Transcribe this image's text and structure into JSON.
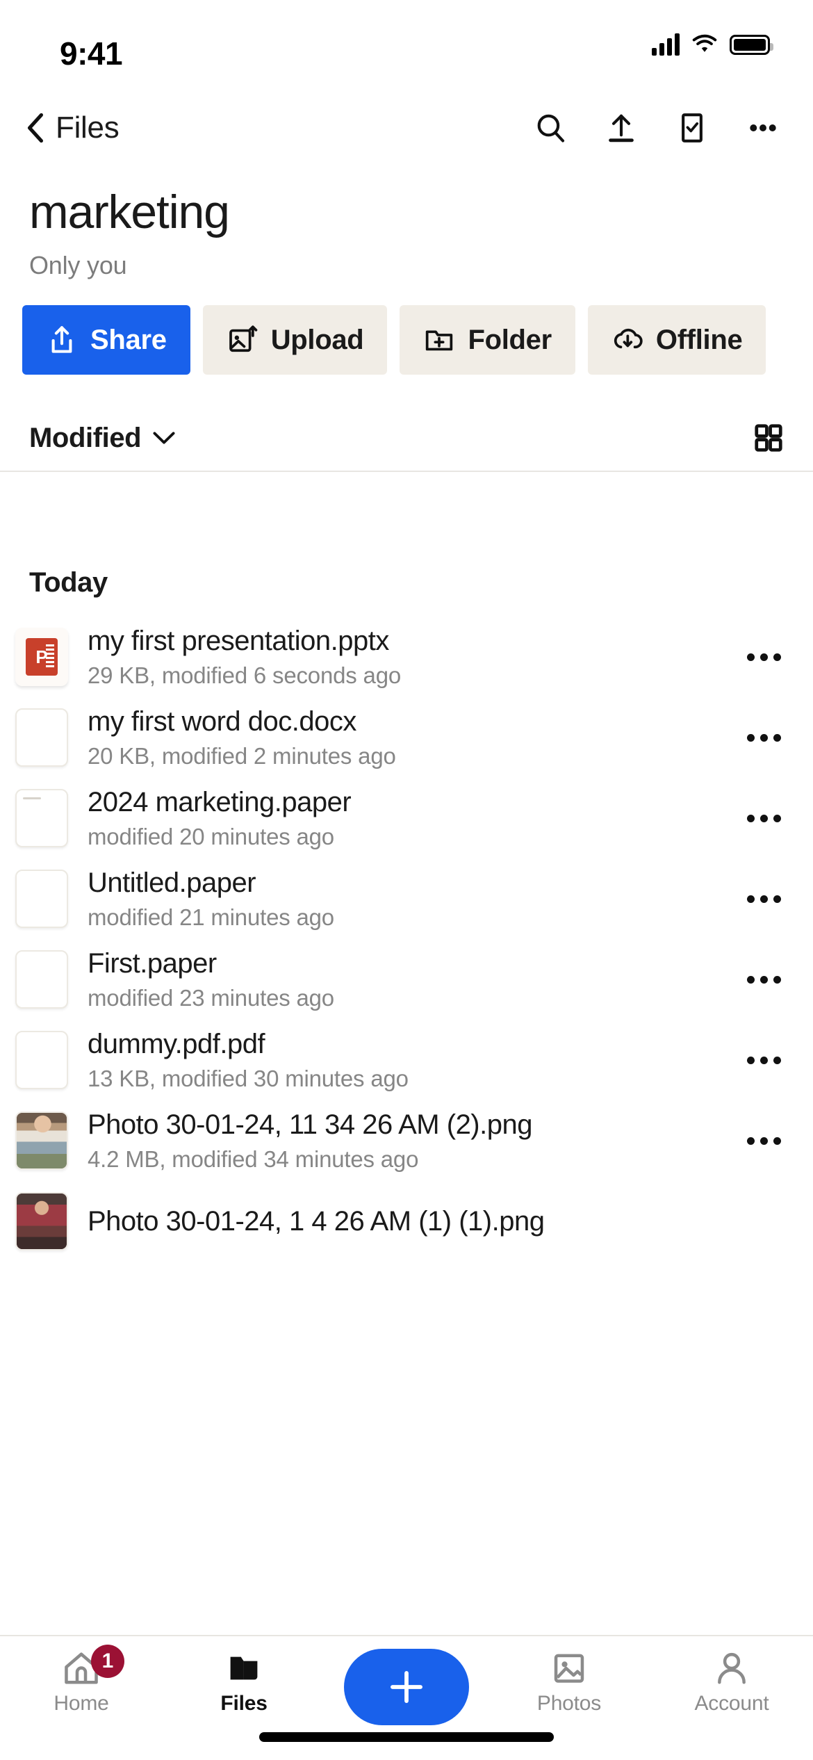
{
  "status_bar": {
    "time": "9:41",
    "signal_icon": "cellular-signal-icon",
    "wifi_icon": "wifi-icon",
    "battery_icon": "battery-full-icon"
  },
  "navbar": {
    "back_label": "Files",
    "back_icon": "chevron-left-icon",
    "actions": [
      {
        "name": "search-icon",
        "label": "Search"
      },
      {
        "name": "upload-icon",
        "label": "Upload"
      },
      {
        "name": "select-checkbox-icon",
        "label": "Select"
      },
      {
        "name": "more-horizontal-icon",
        "label": "More"
      }
    ]
  },
  "header": {
    "title": "marketing",
    "subtitle": "Only you"
  },
  "quick_actions": [
    {
      "label": "Share",
      "icon": "share-icon",
      "primary": true
    },
    {
      "label": "Upload",
      "icon": "image-upload-icon",
      "primary": false
    },
    {
      "label": "Folder",
      "icon": "folder-plus-icon",
      "primary": false
    },
    {
      "label": "Offline",
      "icon": "cloud-download-icon",
      "primary": false
    }
  ],
  "sort_bar": {
    "sort_label": "Modified",
    "sort_chevron_icon": "chevron-down-icon",
    "view_toggle_icon": "grid-view-icon"
  },
  "file_list": {
    "group_label": "Today",
    "items": [
      {
        "name": "my first presentation.pptx",
        "meta": "29 KB, modified 6 seconds ago",
        "thumb_type": "pptx",
        "thumb_glyph": "P",
        "more_icon": "more-horizontal-icon"
      },
      {
        "name": "my first word doc.docx",
        "meta": "20 KB, modified 2 minutes ago",
        "thumb_type": "blank",
        "thumb_glyph": "",
        "more_icon": "more-horizontal-icon"
      },
      {
        "name": "2024 marketing.paper",
        "meta": "modified 20 minutes ago",
        "thumb_type": "paper",
        "thumb_glyph": "",
        "more_icon": "more-horizontal-icon"
      },
      {
        "name": "Untitled.paper",
        "meta": "modified 21 minutes ago",
        "thumb_type": "blank",
        "thumb_glyph": "",
        "more_icon": "more-horizontal-icon"
      },
      {
        "name": "First.paper",
        "meta": "modified 23 minutes ago",
        "thumb_type": "blank",
        "thumb_glyph": "",
        "more_icon": "more-horizontal-icon"
      },
      {
        "name": "dummy.pdf.pdf",
        "meta": "13 KB, modified 30 minutes ago",
        "thumb_type": "blank",
        "thumb_glyph": "",
        "more_icon": "more-horizontal-icon"
      },
      {
        "name": "Photo 30-01-24, 11 34 26 AM (2).png",
        "meta": "4.2 MB, modified 34 minutes ago",
        "thumb_type": "photo-a",
        "thumb_glyph": "",
        "more_icon": "more-horizontal-icon"
      },
      {
        "name": "Photo 30-01-24, 1  4 26 AM (1) (1).png",
        "meta": "",
        "thumb_type": "photo-b",
        "thumb_glyph": "",
        "more_icon": "more-horizontal-icon"
      }
    ]
  },
  "tabbar": {
    "tabs": [
      {
        "label": "Home",
        "icon": "home-icon",
        "badge": "1",
        "active": false
      },
      {
        "label": "Files",
        "icon": "folder-icon",
        "badge": "",
        "active": true
      },
      {
        "label": "",
        "icon": "plus-icon",
        "badge": "",
        "active": false
      },
      {
        "label": "Photos",
        "icon": "photo-icon",
        "badge": "",
        "active": false
      },
      {
        "label": "Account",
        "icon": "person-icon",
        "badge": "",
        "active": false
      }
    ]
  },
  "colors": {
    "brand_blue": "#1961eb",
    "action_surface": "#f1ede6",
    "badge_red": "#9b1134",
    "text_primary": "#1a1a1a",
    "text_secondary": "#868686"
  }
}
